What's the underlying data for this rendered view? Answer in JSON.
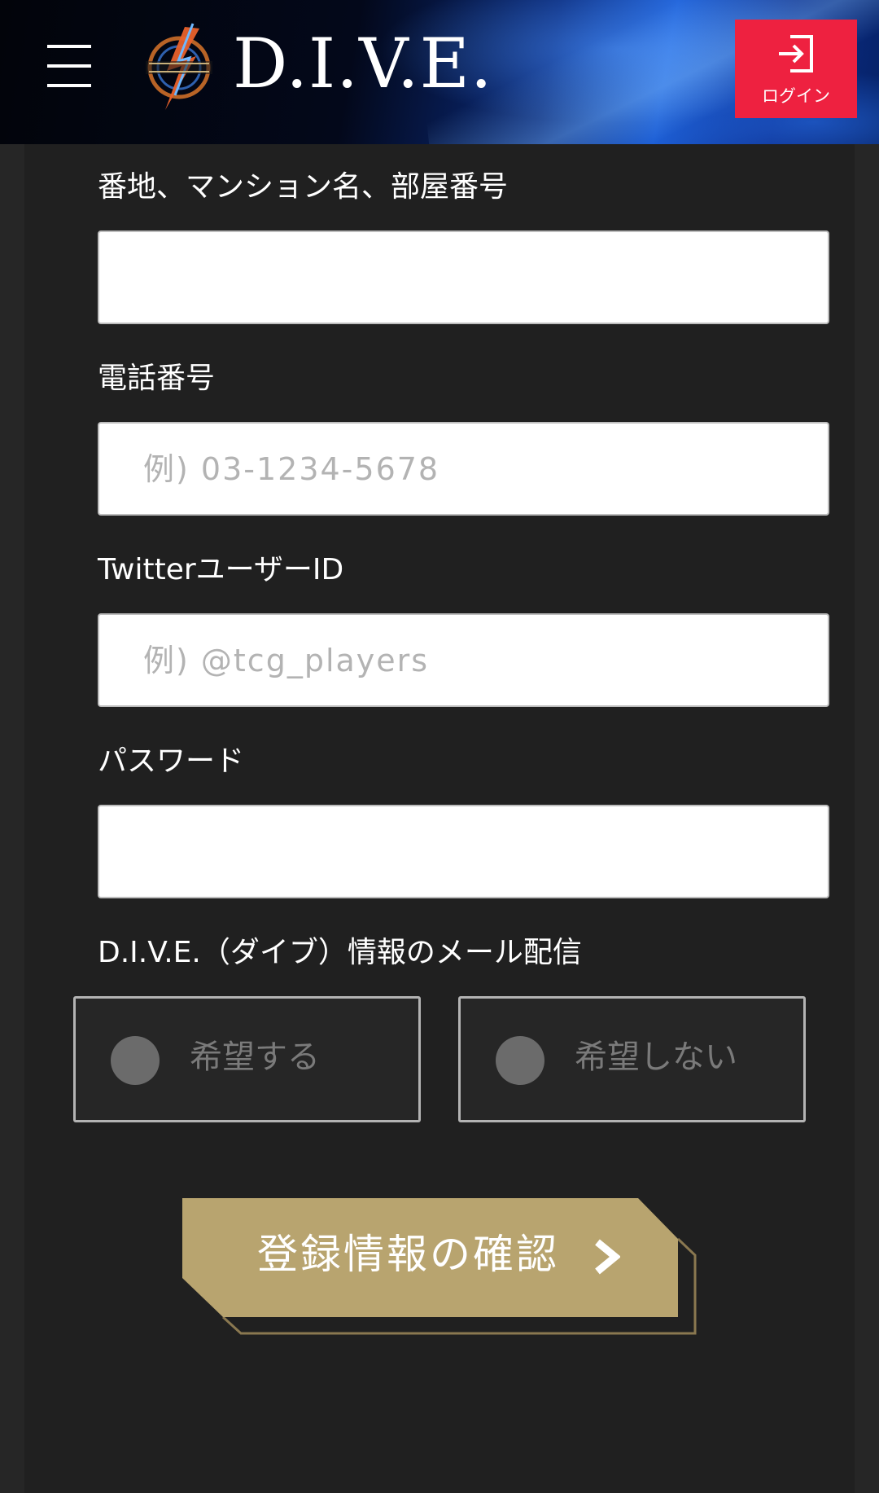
{
  "header": {
    "logo_text": "D.I.V.E.",
    "login_label": "ログイン"
  },
  "form": {
    "address_label": "番地、マンション名、部屋番号",
    "address_value": "",
    "phone_label": "電話番号",
    "phone_placeholder": "例) 03-1234-5678",
    "twitter_label": "TwitterユーザーID",
    "twitter_placeholder": "例) @tcg_players",
    "password_label": "パスワード",
    "password_value": "",
    "mail_label": "D.I.V.E.（ダイブ）情報のメール配信",
    "mail_options": [
      "希望する",
      "希望しない"
    ],
    "submit_label": "登録情報の確認"
  },
  "colors": {
    "login_bg": "#ee2140",
    "submit_bg": "#b8a46f",
    "page_bg": "#262626",
    "panel_bg": "#202020"
  },
  "icons": {
    "menu": "hamburger-icon",
    "login": "login-icon",
    "submit": "chevron-right-icon"
  }
}
